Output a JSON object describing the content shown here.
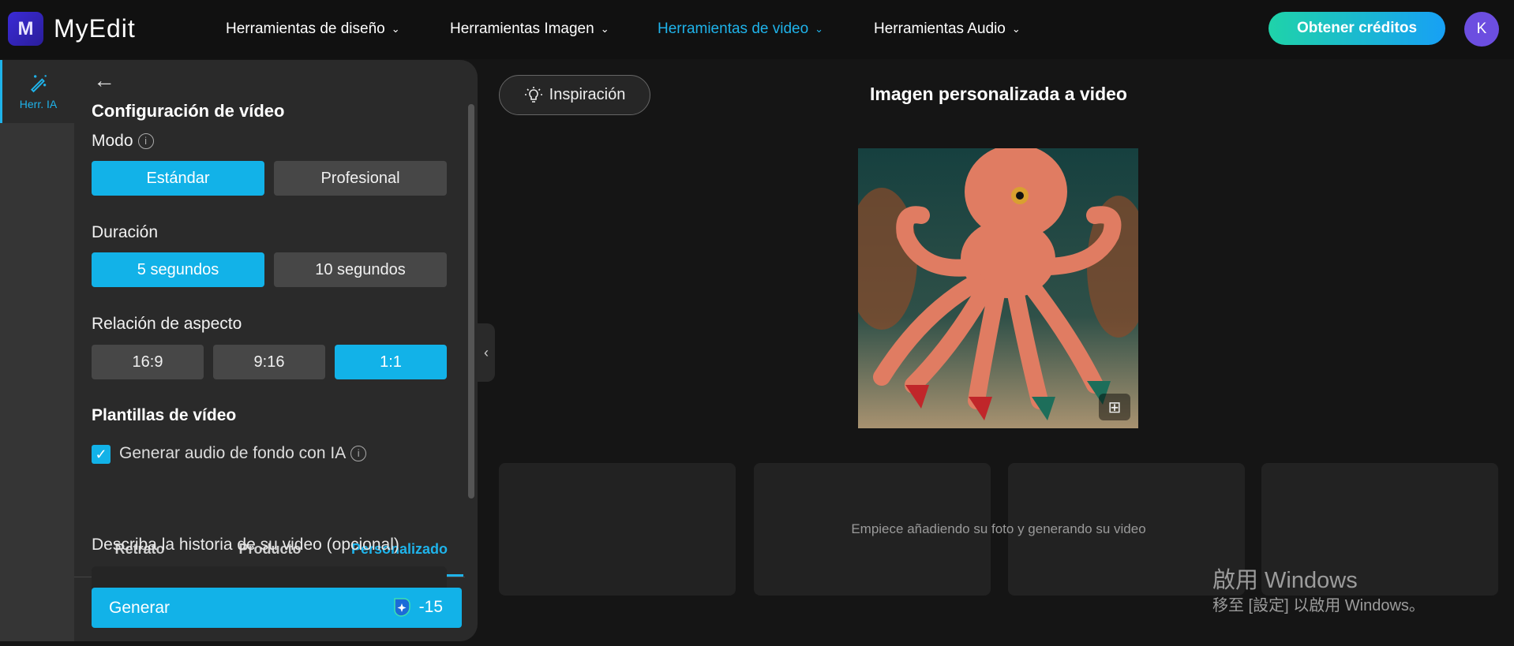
{
  "header": {
    "brand": "MyEdit",
    "logo_letter": "M",
    "nav": [
      {
        "label": "Herramientas de diseño"
      },
      {
        "label": "Herramientas Imagen"
      },
      {
        "label": "Herramientas de video"
      },
      {
        "label": "Herramientas Audio"
      }
    ],
    "credits_label": "Obtener créditos",
    "avatar_letter": "K"
  },
  "rail": {
    "item_label": "Herr. IA"
  },
  "panel": {
    "title": "Configuración de vídeo",
    "mode_label": "Modo",
    "mode_options": [
      "Estándar",
      "Profesional"
    ],
    "duration_label": "Duración",
    "duration_options": [
      "5 segundos",
      "10 segundos"
    ],
    "aspect_label": "Relación de aspecto",
    "aspect_options": [
      "16:9",
      "9:16",
      "1:1"
    ],
    "templates_title": "Plantillas de vídeo",
    "audio_checkbox_label": "Generar audio de fondo con IA",
    "audio_checked": true,
    "tabs": [
      "Retrato",
      "Producto",
      "Personalizado"
    ],
    "story_label": "Describa la historia de su video (opcional)",
    "generate_label": "Generar",
    "cost": "-15"
  },
  "main": {
    "inspiration_label": "Inspiración",
    "title": "Imagen personalizada a video",
    "empty_text": "Empiece añadiendo su foto y generando su video"
  },
  "watermark": {
    "line1": "啟用 Windows",
    "line2": "移至 [設定] 以啟用 Windows。"
  },
  "colors": {
    "accent": "#12b2e8",
    "avatar": "#6c4ee0"
  }
}
